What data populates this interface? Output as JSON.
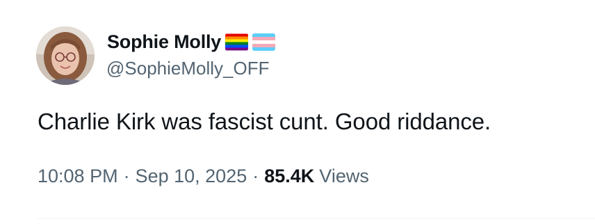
{
  "author": {
    "display_name": "Sophie Molly",
    "handle": "@SophieMolly_OFF",
    "avatar_icon": "profile-photo",
    "flags": [
      {
        "name": "rainbow-pride-flag-icon",
        "colors": [
          "#e40303",
          "#ff8c00",
          "#ffed00",
          "#008026",
          "#004dff",
          "#750787"
        ]
      },
      {
        "name": "transgender-flag-icon",
        "colors": [
          "#5bcefa",
          "#f5a9b8",
          "#ffffff",
          "#f5a9b8",
          "#5bcefa"
        ]
      }
    ]
  },
  "tweet": {
    "text": "Charlie Kirk was fascist cunt. Good riddance."
  },
  "meta": {
    "time": "10:08 PM",
    "separator": "·",
    "date": "Sep 10, 2025",
    "views_count": "85.4K",
    "views_label": "Views"
  },
  "colors": {
    "text_primary": "#0f1419",
    "text_secondary": "#536471",
    "divider": "#eff3f4"
  }
}
